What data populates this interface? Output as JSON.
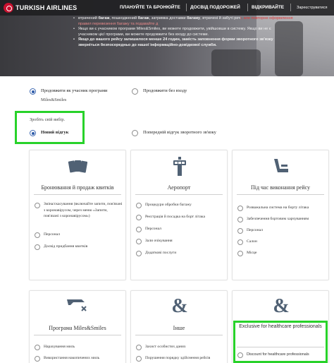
{
  "header": {
    "brand": "TURKISH AIRLINES",
    "nav": [
      "ПЛАНУЙТЕ ТА БРОНЮЙТЕ",
      "ДОСВІД ПОДОРОЖЕЙ",
      "ВІДКРИВАЙТЕ"
    ],
    "register": "Зареєструватися"
  },
  "notes": {
    "line1_a": "втрачений ",
    "line1_b": "багаж",
    "line1_c": ", пошкоджений ",
    "line1_d": "багаж",
    "line1_e": ", затримка доставки ",
    "line1_f": "багажу",
    "line1_g": ", втрачені й забуті реч",
    "line1_h": "і, але повторне оформлення",
    "line2": "правил перевезення багажу та подавайте д",
    "line3": "Якщо ви є учасником програми Miles&Smiles, ви можете продовжити, увійшовши в систему. Якщо ви не є",
    "line4": "учасником цієї програми, ви можете продовжити без входу до системи.",
    "line5": "Якщо до вашого рейсу залишилося менше 24 годин, замість заповнення форми зворотного зв'язку",
    "line6": "зверніться безпосередньо до нашої інформаційно-довідкової служби."
  },
  "login": {
    "member_label": "Продовжити як учасник програми",
    "member_sub": "Miles&Smiles",
    "guest_label": "Продовжити без входу"
  },
  "choice": {
    "prompt": "Зробіть свій вибір.",
    "new_label": "Новий відгук",
    "previous_label": "Попередній відгук зворотного зв'язку"
  },
  "cards": [
    {
      "icon": "tickets-icon",
      "title": "Бронювання й продаж квитків",
      "options": [
        "Зміна/скасування (включайте запити, пов'язані з коронавірусом, через меню «Запити, пов'язані з коронавірусом»)",
        "Персонал",
        "Досвід придбання квитків"
      ]
    },
    {
      "icon": "control-tower-icon",
      "title": "Аеропорт",
      "options": [
        "Процедури обробки багажу",
        "Реєстрація й посадка на борт літака",
        "Персонал",
        "Зали очікування",
        "Додаткові послуги"
      ]
    },
    {
      "icon": "airplane-seat-icon",
      "title": "Під час виконання рейсу",
      "options": [
        "Розважальна система на борту літака",
        "Забезпечення бортовим харчуванням",
        "Персонал",
        "Салон",
        "Місце"
      ]
    },
    {
      "icon": "miles-plane-icon",
      "title": "Програма Miles&Smiles",
      "options": [
        "Нарахування миль",
        "Використання накопичених миль"
      ]
    },
    {
      "icon": "ampersand-icon",
      "title": "Інше",
      "options": [
        "Захист особистих даних",
        "Порушення порядку здійснення рейсів"
      ]
    },
    {
      "icon": "ampersand-icon",
      "title": "Exclusive for healthcare professionals",
      "options": [
        "Discount for healthcare professionals"
      ]
    }
  ],
  "colors": {
    "accent_blue": "#2c5aa8",
    "highlight_green": "#28d22a",
    "brand_red": "#c8102e"
  }
}
